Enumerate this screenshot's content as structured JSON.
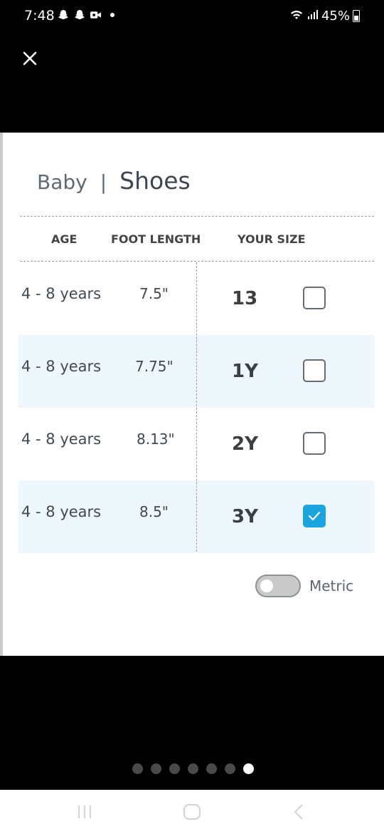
{
  "status_bar": {
    "time": "7:48",
    "left_icons": [
      "snapchat-icon",
      "snapchat-icon",
      "video-call-icon",
      "dot-icon"
    ],
    "battery_percent": "45%",
    "battery_level": 0.45
  },
  "header": {
    "category": "Baby",
    "separator": "|",
    "title": "Shoes"
  },
  "table": {
    "columns": [
      "AGE",
      "FOOT LENGTH",
      "YOUR SIZE"
    ],
    "rows": [
      {
        "age": "4 - 8 years",
        "foot_length": "7.5\"",
        "size": "13",
        "checked": false
      },
      {
        "age": "4 - 8 years",
        "foot_length": "7.75\"",
        "size": "1Y",
        "checked": false
      },
      {
        "age": "4 - 8 years",
        "foot_length": "8.13\"",
        "size": "2Y",
        "checked": false
      },
      {
        "age": "4 - 8 years",
        "foot_length": "8.5\"",
        "size": "3Y",
        "checked": true
      }
    ]
  },
  "metric_toggle": {
    "label": "Metric",
    "on": false
  },
  "pager": {
    "total": 7,
    "active_index": 6
  },
  "colors": {
    "accent": "#1aa4e0",
    "row_shade": "#eef7fb"
  }
}
